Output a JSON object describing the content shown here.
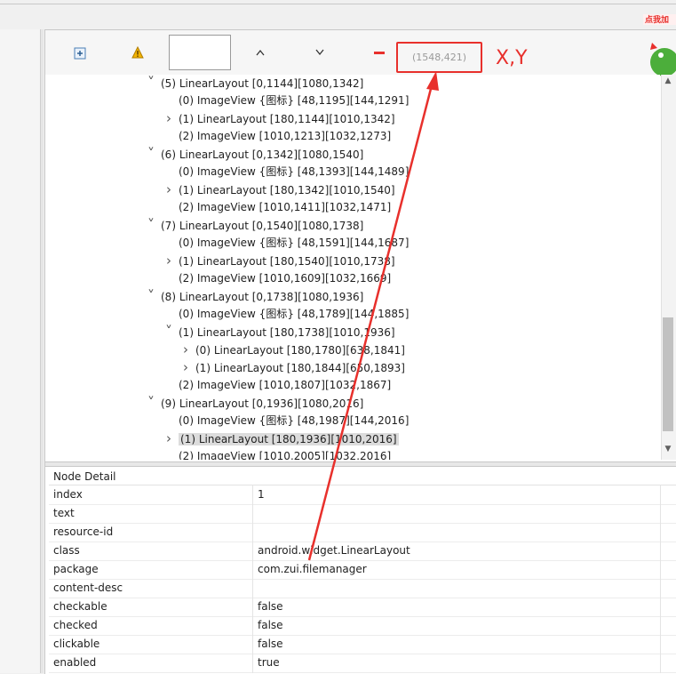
{
  "toolbar": {
    "expand_icon": "expand-all-icon",
    "warning_icon": "warning-icon",
    "search_value": "",
    "prev_glyph": "^",
    "next_glyph": "v",
    "coordinate": "(1548,421)",
    "coordinate_annotation": "X,Y",
    "ad_text": "点我加"
  },
  "tree": [
    {
      "indent": 0,
      "chevron": "down",
      "label": "(5) LinearLayout [0,1144][1080,1342]"
    },
    {
      "indent": 1,
      "chevron": "none",
      "label": "(0) ImageView {图标} [48,1195][144,1291]"
    },
    {
      "indent": 1,
      "chevron": "right",
      "label": "(1) LinearLayout [180,1144][1010,1342]"
    },
    {
      "indent": 1,
      "chevron": "none",
      "label": "(2) ImageView [1010,1213][1032,1273]"
    },
    {
      "indent": 0,
      "chevron": "down",
      "label": "(6) LinearLayout [0,1342][1080,1540]"
    },
    {
      "indent": 1,
      "chevron": "none",
      "label": "(0) ImageView {图标} [48,1393][144,1489]"
    },
    {
      "indent": 1,
      "chevron": "right",
      "label": "(1) LinearLayout [180,1342][1010,1540]"
    },
    {
      "indent": 1,
      "chevron": "none",
      "label": "(2) ImageView [1010,1411][1032,1471]"
    },
    {
      "indent": 0,
      "chevron": "down",
      "label": "(7) LinearLayout [0,1540][1080,1738]"
    },
    {
      "indent": 1,
      "chevron": "none",
      "label": "(0) ImageView {图标} [48,1591][144,1687]"
    },
    {
      "indent": 1,
      "chevron": "right",
      "label": "(1) LinearLayout [180,1540][1010,1738]"
    },
    {
      "indent": 1,
      "chevron": "none",
      "label": "(2) ImageView [1010,1609][1032,1669]"
    },
    {
      "indent": 0,
      "chevron": "down",
      "label": "(8) LinearLayout [0,1738][1080,1936]"
    },
    {
      "indent": 1,
      "chevron": "none",
      "label": "(0) ImageView {图标} [48,1789][144,1885]"
    },
    {
      "indent": 1,
      "chevron": "down",
      "label": "(1) LinearLayout [180,1738][1010,1936]"
    },
    {
      "indent": 2,
      "chevron": "right",
      "label": "(0) LinearLayout [180,1780][638,1841]"
    },
    {
      "indent": 2,
      "chevron": "right",
      "label": "(1) LinearLayout [180,1844][650,1893]"
    },
    {
      "indent": 1,
      "chevron": "none",
      "label": "(2) ImageView [1010,1807][1032,1867]"
    },
    {
      "indent": 0,
      "chevron": "down",
      "label": "(9) LinearLayout [0,1936][1080,2016]"
    },
    {
      "indent": 1,
      "chevron": "none",
      "label": "(0) ImageView {图标} [48,1987][144,2016]"
    },
    {
      "indent": 1,
      "chevron": "right",
      "label": "(1) LinearLayout [180,1936][1010,2016]",
      "selected": true
    },
    {
      "indent": 1,
      "chevron": "none",
      "label": "(2) ImageView [1010,2005][1032,2016]"
    }
  ],
  "detail": {
    "title": "Node Detail",
    "rows": [
      {
        "key": "index",
        "value": "1"
      },
      {
        "key": "text",
        "value": ""
      },
      {
        "key": "resource-id",
        "value": ""
      },
      {
        "key": "class",
        "value": "android.widget.LinearLayout"
      },
      {
        "key": "package",
        "value": "com.zui.filemanager"
      },
      {
        "key": "content-desc",
        "value": ""
      },
      {
        "key": "checkable",
        "value": "false"
      },
      {
        "key": "checked",
        "value": "false"
      },
      {
        "key": "clickable",
        "value": "false"
      },
      {
        "key": "enabled",
        "value": "true"
      }
    ]
  },
  "colors": {
    "annotation_red": "#e8302c",
    "selection": "#dcdcdc"
  }
}
